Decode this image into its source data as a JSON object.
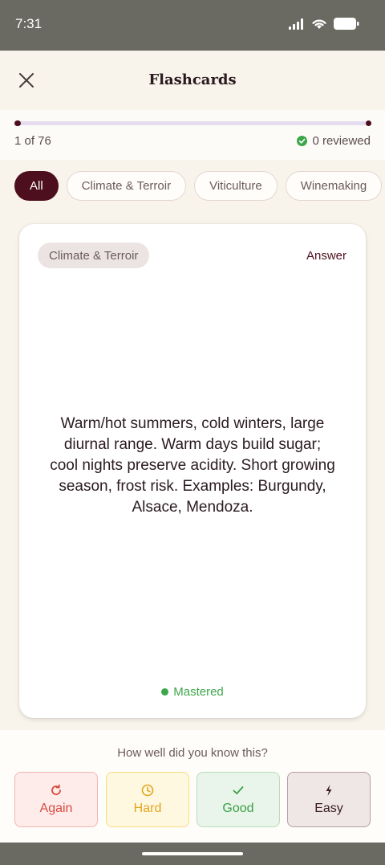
{
  "status_bar": {
    "time": "7:31"
  },
  "header": {
    "title": "Flashcards",
    "close_icon": "close-icon"
  },
  "progress": {
    "count_text": "1 of 76",
    "reviewed_text": "0 reviewed",
    "current": 1,
    "total": 76
  },
  "filters": [
    {
      "label": "All",
      "active": true
    },
    {
      "label": "Climate & Terroir",
      "active": false
    },
    {
      "label": "Viticulture",
      "active": false
    },
    {
      "label": "Winemaking",
      "active": false
    }
  ],
  "card": {
    "category": "Climate & Terroir",
    "side_label": "Answer",
    "text": "Warm/hot summers, cold winters, large diurnal range. Warm days build sugar; cool nights preserve acidity. Short growing season, frost risk. Examples: Burgundy, Alsace, Mendoza.",
    "status": "Mastered"
  },
  "rating": {
    "prompt": "How well did you know this?",
    "buttons": [
      {
        "label": "Again",
        "icon": "refresh-icon"
      },
      {
        "label": "Hard",
        "icon": "clock-icon"
      },
      {
        "label": "Good",
        "icon": "check-icon"
      },
      {
        "label": "Easy",
        "icon": "lightning-icon"
      }
    ]
  },
  "colors": {
    "accent": "#4d0f1d",
    "mastered": "#3ea64a",
    "background": "#f8f4ec"
  }
}
